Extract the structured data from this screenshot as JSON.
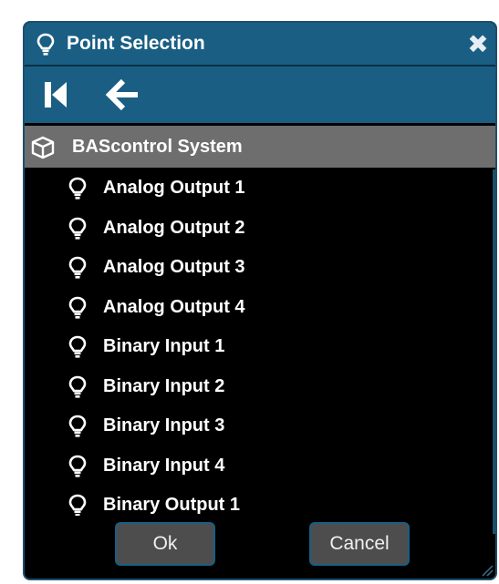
{
  "dialog": {
    "title": "Point Selection",
    "title_icon": "lightbulb-icon",
    "close_icon": "close-icon",
    "close_symbol": "✖"
  },
  "toolbar": {
    "first_icon": "skip-to-start-icon",
    "back_icon": "arrow-left-icon"
  },
  "tree": {
    "root_label": "BAScontrol System",
    "root_icon": "cube-icon",
    "item_icon": "lightbulb-icon",
    "items": [
      {
        "label": "Analog Output 1"
      },
      {
        "label": "Analog Output 2"
      },
      {
        "label": "Analog Output 3"
      },
      {
        "label": "Analog Output 4"
      },
      {
        "label": "Binary Input 1"
      },
      {
        "label": "Binary Input 2"
      },
      {
        "label": "Binary Input 3"
      },
      {
        "label": "Binary Input 4"
      },
      {
        "label": "Binary Output 1"
      }
    ]
  },
  "footer": {
    "ok_label": "Ok",
    "cancel_label": "Cancel"
  },
  "colors": {
    "header_bg": "#1a5e83",
    "list_bg": "#000000",
    "root_row_bg": "#6e6e6e",
    "button_bg": "#4d4d4d",
    "text": "#ffffff"
  }
}
